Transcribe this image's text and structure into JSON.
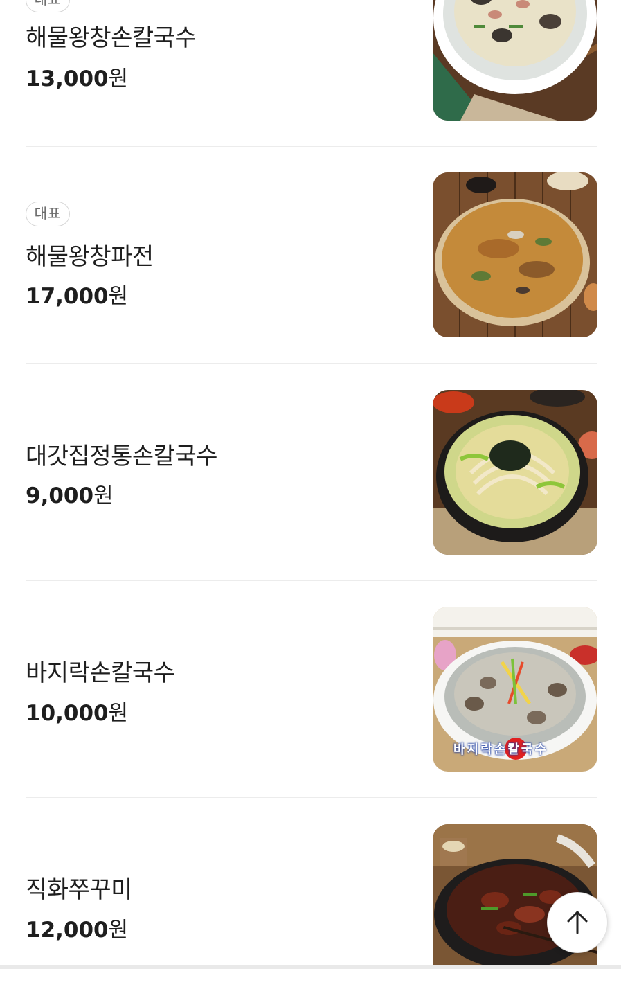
{
  "menu": {
    "items": [
      {
        "badge": "대표",
        "name": "해물왕창손칼국수",
        "price": "13,000",
        "currency": "원",
        "photo": "seafood-kalguksu-photo"
      },
      {
        "badge": "대표",
        "name": "해물왕창파전",
        "price": "17,000",
        "currency": "원",
        "photo": "seafood-pajeon-photo"
      },
      {
        "badge": "",
        "name": "대갓집정통손칼국수",
        "price": "9,000",
        "currency": "원",
        "photo": "traditional-kalguksu-photo"
      },
      {
        "badge": "",
        "name": "바지락손칼국수",
        "price": "10,000",
        "currency": "원",
        "photo": "clam-kalguksu-photo",
        "photo_caption": "바지락손칼국수"
      },
      {
        "badge": "",
        "name": "직화쭈꾸미",
        "price": "12,000",
        "currency": "원",
        "photo": "grilled-webfoot-octopus-photo"
      }
    ]
  },
  "scroll_top": {
    "icon": "arrow-up-icon"
  },
  "colors": {
    "text": "#1e1e1e",
    "badge_border": "#d6d6d6",
    "badge_text": "#6b6b6b",
    "divider": "#ececec"
  }
}
